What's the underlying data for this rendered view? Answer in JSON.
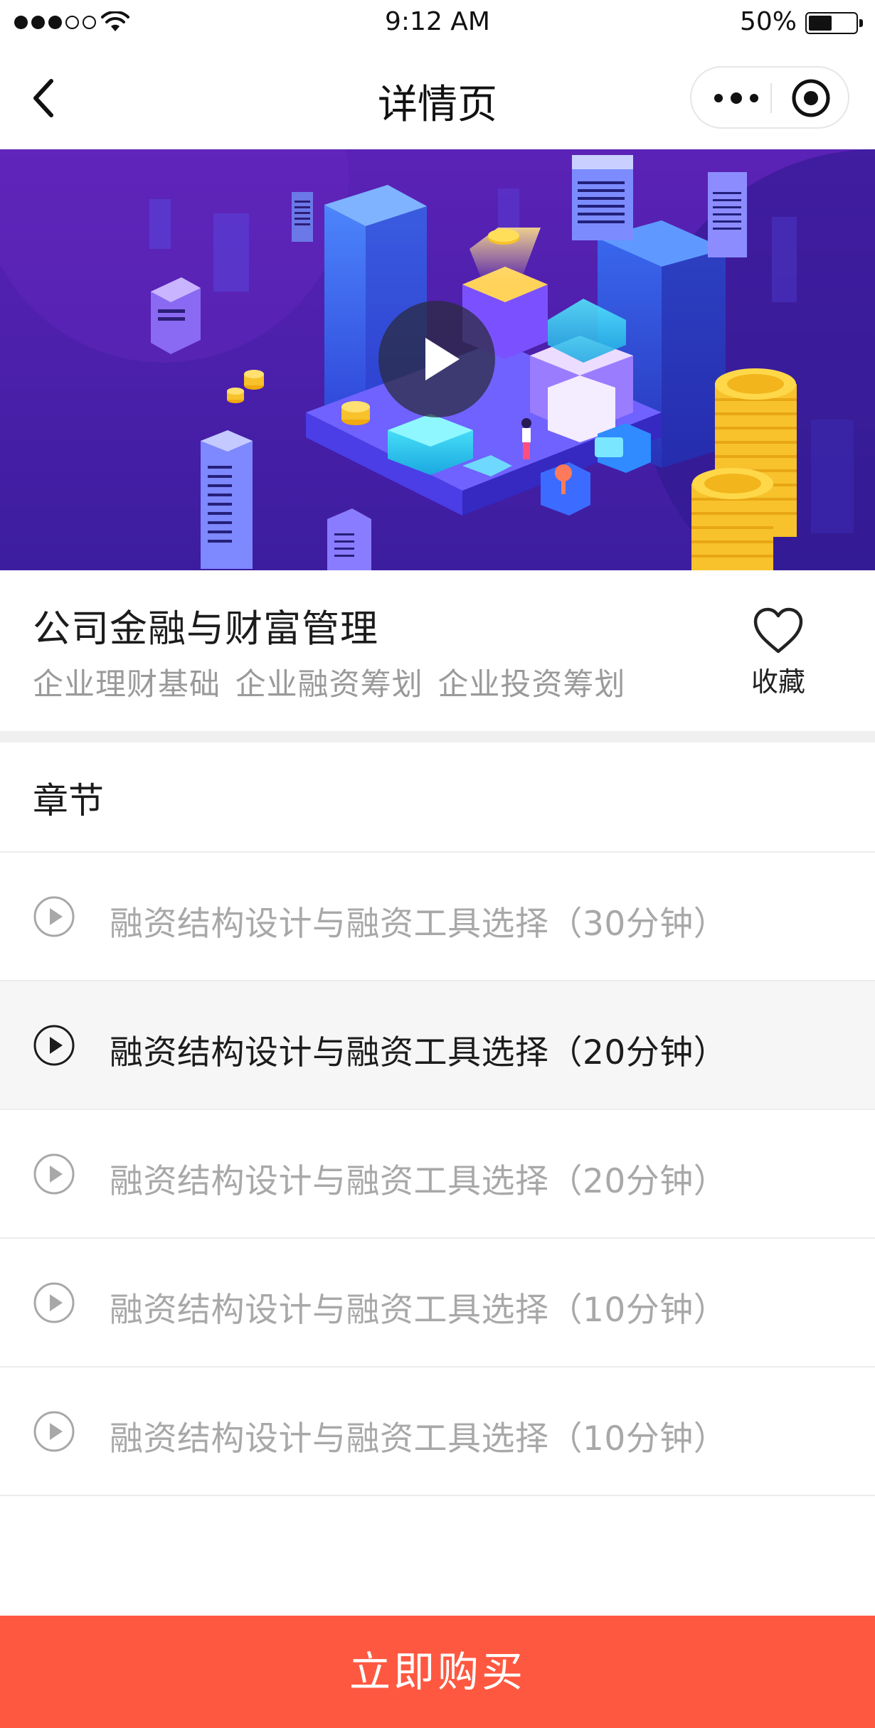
{
  "status_bar": {
    "time": "9:12 AM",
    "battery_percent": "50%",
    "battery_level": 0.5,
    "signal_bars_filled": 3,
    "signal_bars_total": 5
  },
  "nav": {
    "title": "详情页",
    "back_icon": "chevron-left-icon",
    "more_icon": "more-dots-icon",
    "close_icon": "target-circle-icon"
  },
  "banner": {
    "play_icon": "play-icon",
    "colors": {
      "background_top": "#5a22b8",
      "background_bottom": "#3a1c9e",
      "coin": "#f7c22b"
    }
  },
  "course": {
    "title": "公司金融与财富管理",
    "tags": "企业理财基础 企业融资筹划 企业投资筹划",
    "favorite_label": "收藏",
    "favorite_icon": "heart-outline-icon"
  },
  "chapters": {
    "header": "章节",
    "items": [
      {
        "label": "融资结构设计与融资工具选择（30分钟）",
        "active": false
      },
      {
        "label": "融资结构设计与融资工具选择（20分钟）",
        "active": true
      },
      {
        "label": "融资结构设计与融资工具选择（20分钟）",
        "active": false
      },
      {
        "label": "融资结构设计与融资工具选择（10分钟）",
        "active": false
      },
      {
        "label": "融资结构设计与融资工具选择（10分钟）",
        "active": false
      }
    ]
  },
  "buy": {
    "label": "立即购买",
    "color": "#ff5841"
  }
}
